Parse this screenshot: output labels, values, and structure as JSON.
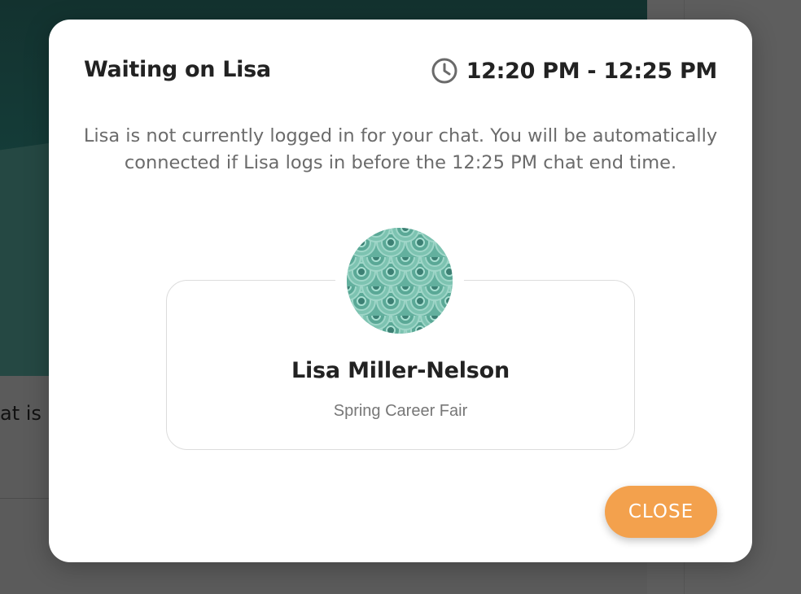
{
  "background": {
    "partial_text": "at is li"
  },
  "modal": {
    "title": "Waiting on Lisa",
    "time_range": "12:20 PM - 12:25 PM",
    "clock_icon": "clock-icon",
    "message": "Lisa is not currently logged in for your chat. You will be automatically connected if Lisa logs in before the 12:25 PM chat end time.",
    "profile": {
      "name": "Lisa Miller-Nelson",
      "event": "Spring Career Fair",
      "avatar_pattern_color": "#63b09e"
    },
    "close_label": "CLOSE",
    "close_color": "#f3a14d"
  }
}
